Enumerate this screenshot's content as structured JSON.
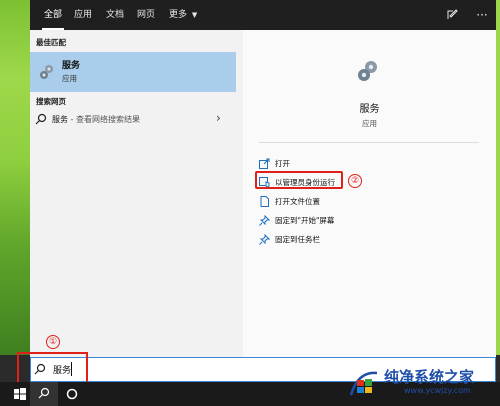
{
  "tabs": [
    {
      "label": "全部"
    },
    {
      "label": "应用"
    },
    {
      "label": "文档"
    },
    {
      "label": "网页"
    },
    {
      "label": "更多"
    }
  ],
  "left": {
    "best_match_heading": "最佳匹配",
    "best_match": {
      "title": "服务",
      "subtitle": "应用"
    },
    "web_heading": "搜索网页",
    "web_item": {
      "term": "服务",
      "suffix": " - 查看网络搜索结果"
    }
  },
  "right": {
    "app_title": "服务",
    "app_subtitle": "应用",
    "actions": [
      {
        "label": "打开",
        "icon": "open-icon"
      },
      {
        "label": "以管理员身份运行",
        "icon": "run-as-admin-icon"
      },
      {
        "label": "打开文件位置",
        "icon": "file-location-icon"
      },
      {
        "label": "固定到\"开始\"屏幕",
        "icon": "pin-start-icon"
      },
      {
        "label": "固定到任务栏",
        "icon": "pin-taskbar-icon"
      }
    ]
  },
  "annotations": {
    "marker1": "①",
    "marker2": "②"
  },
  "search": {
    "value": "服务"
  },
  "watermark": {
    "title": "纯净系统之家",
    "url": "www.ycwjzy.com"
  },
  "colors": {
    "accent_red": "#e0201b",
    "selection": "#a9cdea",
    "brand_blue": "#1e4fa8"
  }
}
